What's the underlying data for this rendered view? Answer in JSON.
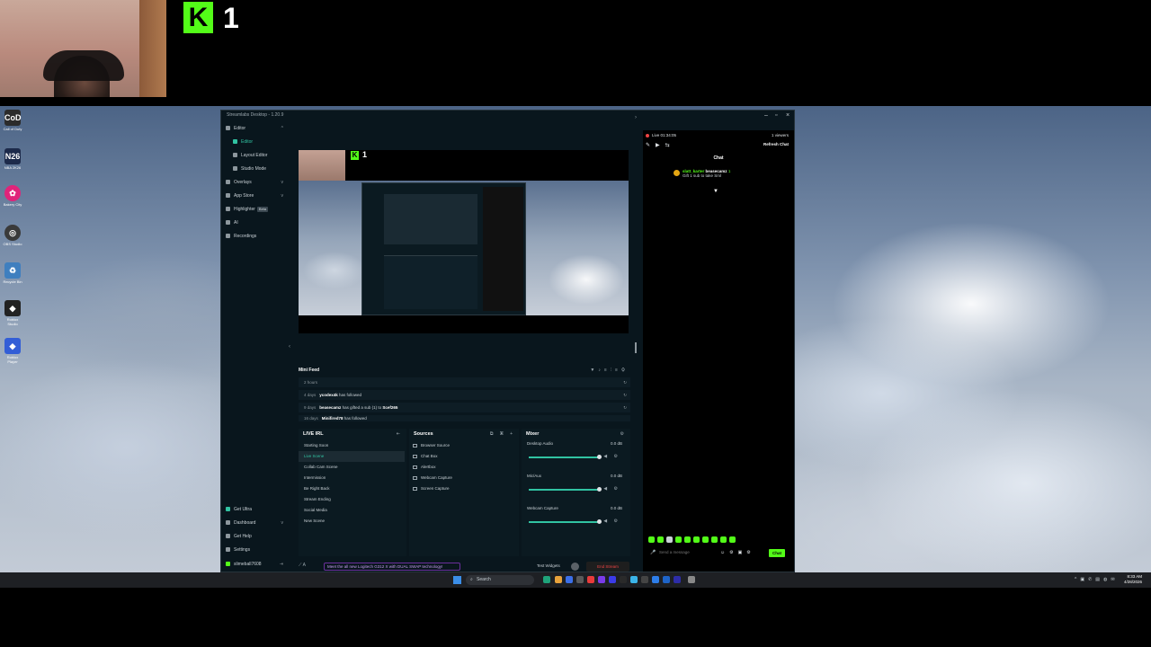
{
  "overlay": {
    "kick_logo": "K",
    "viewer_count": "1"
  },
  "desktop_icons": [
    {
      "label": "Call of Duty",
      "glyph": "CoD",
      "color": "#2b2b2b"
    },
    {
      "label": "NBA 2K26",
      "glyph": "N26",
      "color": "#1d2a4a"
    },
    {
      "label": "Bakery City",
      "glyph": "✿",
      "color": "#e0247a"
    },
    {
      "label": "OBS Studio",
      "glyph": "◎",
      "color": "#3a3a3a"
    },
    {
      "label": "Recycle Bin",
      "glyph": "♻",
      "color": "#3f7fbf"
    },
    {
      "label": "Roblox Studio",
      "glyph": "◆",
      "color": "#222"
    },
    {
      "label": "Roblox Player",
      "glyph": "◆",
      "color": "#335ed6"
    }
  ],
  "window": {
    "title": "Streamlabs Desktop - 1.20.9"
  },
  "nav": {
    "editor": "Editor",
    "editor_sub": "Editor",
    "layout_editor": "Layout Editor",
    "studio_mode": "Studio Mode",
    "overlays": "Overlays",
    "app_store": "App Store",
    "highlighter": "Highlighter",
    "beta": "Beta",
    "ai": "AI",
    "recordings": "Recordings",
    "get_ultra": "Get Ultra",
    "dashboard": "Dashboard",
    "get_help": "Get Help",
    "settings": "Settings",
    "username": "slimeball7608"
  },
  "minifeed": {
    "title": "Mini Feed",
    "rows": [
      {
        "age": "2 hours",
        "user": "",
        "text": "",
        "target": ""
      },
      {
        "age": "4 days",
        "user": "ycodex4k",
        "text": "has followed",
        "target": ""
      },
      {
        "age": "9 days",
        "user": "beasecamz",
        "text": "has gifted a sub (1) to",
        "target": "Scef265"
      },
      {
        "age": "16 days",
        "user": "Minifired78",
        "text": "has followed",
        "target": ""
      }
    ]
  },
  "scenes": {
    "title": "LIVE IRL",
    "items": [
      "Starting Soon",
      "Live Scene",
      "Collab Cam Scene",
      "Intermission",
      "Be Right Back",
      "Stream Ending",
      "Social Media",
      "New Scene"
    ],
    "active_index": 1
  },
  "sources": {
    "title": "Sources",
    "items": [
      "Browser Source",
      "Chat Box",
      "Alertbox",
      "Webcam Capture",
      "Screen Capture"
    ]
  },
  "mixer": {
    "title": "Mixer",
    "channels": [
      {
        "name": "Desktop Audio",
        "db": "0.0 dB",
        "level": 1.0
      },
      {
        "name": "Mic/Aux",
        "db": "0.0 dB",
        "level": 1.0
      },
      {
        "name": "Webcam Capture",
        "db": "0.0 dB",
        "level": 1.0
      }
    ]
  },
  "footer": {
    "promo": "Meet the all new Logitech G312 X with DUAL SWAP technology!",
    "test_widgets": "Test Widgets",
    "end_stream": "End Stream"
  },
  "chat": {
    "live_time": "Live 01:34:05",
    "viewers": "1 viewers",
    "refresh": "Refresh Chat",
    "title": "Chat",
    "message_user1": "slatt_karter",
    "message_user2": "beasecamz",
    "message_badge": "1",
    "message_text": "Gift 1 sub to take Sml",
    "input_placeholder": "Send a message",
    "send_label": "Chat"
  },
  "taskbar": {
    "search_placeholder": "Search",
    "time": "8:33 AM",
    "date": "4/28/2026"
  }
}
